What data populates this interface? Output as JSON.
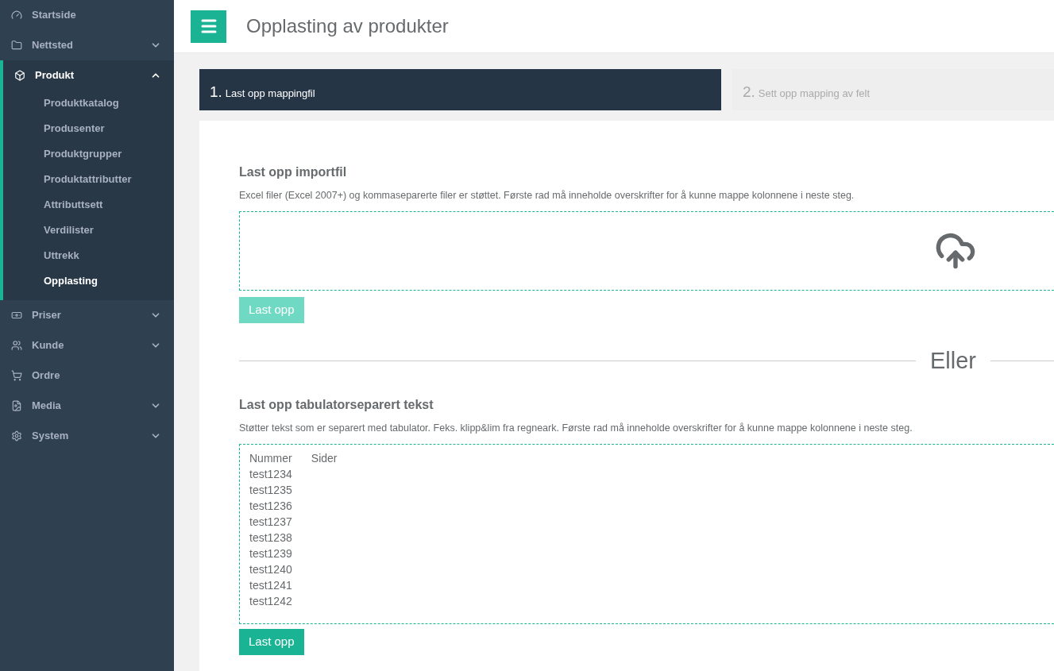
{
  "sidebar": {
    "items": [
      {
        "label": "Startside",
        "expanded": false,
        "has_children": false
      },
      {
        "label": "Nettsted",
        "expanded": false,
        "has_children": true
      },
      {
        "label": "Produkt",
        "expanded": true,
        "has_children": true,
        "children": [
          {
            "label": "Produktkatalog",
            "selected": false
          },
          {
            "label": "Produsenter",
            "selected": false
          },
          {
            "label": "Produktgrupper",
            "selected": false
          },
          {
            "label": "Produktattributter",
            "selected": false
          },
          {
            "label": "Attributtsett",
            "selected": false
          },
          {
            "label": "Verdilister",
            "selected": false
          },
          {
            "label": "Uttrekk",
            "selected": false
          },
          {
            "label": "Opplasting",
            "selected": true
          }
        ]
      },
      {
        "label": "Priser",
        "expanded": false,
        "has_children": true
      },
      {
        "label": "Kunde",
        "expanded": false,
        "has_children": true
      },
      {
        "label": "Ordre",
        "expanded": false,
        "has_children": false
      },
      {
        "label": "Media",
        "expanded": false,
        "has_children": true
      },
      {
        "label": "System",
        "expanded": false,
        "has_children": true
      }
    ]
  },
  "header": {
    "title": "Opplasting av produkter"
  },
  "steps": [
    {
      "number": "1.",
      "label": "Last opp mappingfil",
      "selected": true
    },
    {
      "number": "2.",
      "label": "Sett opp mapping av felt",
      "selected": false
    }
  ],
  "file_upload": {
    "heading": "Last opp importfil",
    "description": "Excel filer (Excel 2007+) og kommaseparerte filer er støttet. Første rad må inneholde overskrifter for å kunne mappe kolonnene i neste steg.",
    "button": {
      "label": "Last opp",
      "disabled": true
    }
  },
  "divider": {
    "label": "Eller"
  },
  "text_upload": {
    "heading": "Last opp tabulatorseparert tekst",
    "description": "Støtter tekst som er separert med tabulator. Feks. klipp&lim fra regneark. Første rad må inneholde overskrifter for å kunne mappe kolonnene i neste steg.",
    "value": "Nummer\tSider\ntest1234\ntest1235\ntest1236\ntest1237\ntest1238\ntest1239\ntest1240\ntest1241\ntest1242\t",
    "button": {
      "label": "Last opp",
      "disabled": false
    }
  }
}
